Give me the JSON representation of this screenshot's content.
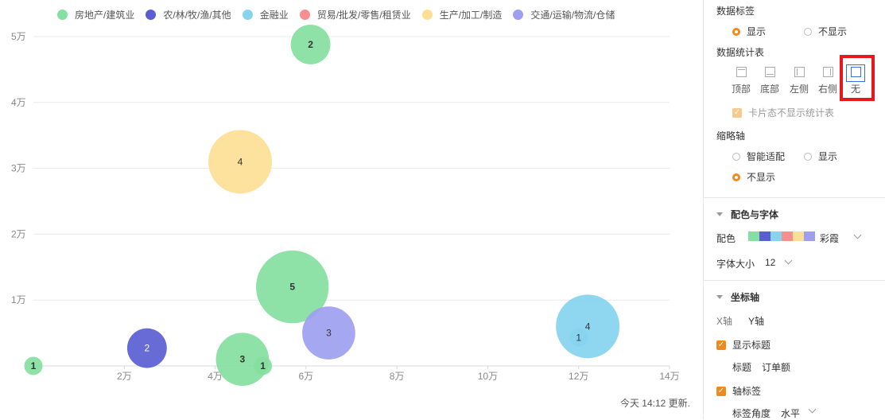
{
  "chart_data": {
    "type": "scatter",
    "subtype": "bubble",
    "legend_position": "top-left",
    "grid": "horizontal",
    "xlim": [
      0,
      140000
    ],
    "ylim": [
      0,
      50000
    ],
    "x_ticks": [
      20000,
      40000,
      60000,
      80000,
      100000,
      120000,
      140000
    ],
    "x_tick_labels": [
      "2万",
      "4万",
      "6万",
      "8万",
      "10万",
      "12万",
      "14万"
    ],
    "y_ticks": [
      10000,
      20000,
      30000,
      40000,
      50000
    ],
    "y_tick_labels": [
      "1万",
      "2万",
      "3万",
      "4万",
      "5万"
    ],
    "series": [
      {
        "name": "房地产/建筑业",
        "color": "#84e0a0",
        "points": [
          {
            "x": 0,
            "y": 0,
            "size": 1
          },
          {
            "x": 61000,
            "y": 48800,
            "size": 2
          },
          {
            "x": 57000,
            "y": 12000,
            "size": 5
          },
          {
            "x": 46000,
            "y": 1000,
            "size": 3
          },
          {
            "x": 50500,
            "y": 0,
            "size": 1
          }
        ]
      },
      {
        "name": "农/林/牧/渔/其他",
        "color": "#5a5ed2",
        "points": [
          {
            "x": 25000,
            "y": 2700,
            "size": 2
          }
        ]
      },
      {
        "name": "金融业",
        "color": "#86d4f0",
        "points": [
          {
            "x": 122000,
            "y": 6000,
            "size": 4
          },
          {
            "x": 120000,
            "y": 4300,
            "size": 1
          }
        ]
      },
      {
        "name": "贸易/批发/零售/租赁业",
        "color": "#f78f8f",
        "points": []
      },
      {
        "name": "生产/加工/制造",
        "color": "#fcdf95",
        "points": [
          {
            "x": 45500,
            "y": 31000,
            "size": 4
          }
        ]
      },
      {
        "name": "交通/运输/物流/仓储",
        "color": "#9da0f0",
        "points": [
          {
            "x": 65000,
            "y": 5000,
            "size": 3
          }
        ]
      }
    ]
  },
  "footer": {
    "update_text": "今天 14:12 更新."
  },
  "panel": {
    "data_label": {
      "title": "数据标签",
      "options": [
        {
          "label": "显示",
          "selected": true
        },
        {
          "label": "不显示",
          "selected": false
        }
      ]
    },
    "stat_table": {
      "title": "数据统计表",
      "positions": [
        {
          "label": "顶部",
          "icon": "table-top-icon"
        },
        {
          "label": "底部",
          "icon": "table-bottom-icon"
        },
        {
          "label": "左侧",
          "icon": "table-left-icon"
        },
        {
          "label": "右侧",
          "icon": "table-right-icon"
        },
        {
          "label": "无",
          "icon": "table-none-icon",
          "selected": true
        }
      ],
      "card_hide_label": "卡片态不显示统计表"
    },
    "thumb_axis": {
      "title": "缩略轴",
      "options": [
        {
          "label": "智能适配",
          "selected": false
        },
        {
          "label": "显示",
          "selected": false
        },
        {
          "label": "不显示",
          "selected": true
        }
      ]
    },
    "color_font": {
      "title": "配色与字体",
      "palette_label": "配色",
      "palette_name": "彩霞",
      "palette_colors": [
        "#84e0a0",
        "#5a5ed2",
        "#86d4f0",
        "#f78f8f",
        "#fcdf95",
        "#9da0f0"
      ],
      "font_size_label": "字体大小",
      "font_size_value": "12"
    },
    "axis": {
      "title": "坐标轴",
      "tab_x": "X轴",
      "tab_y": "Y轴",
      "show_title_label": "显示标题",
      "title_label": "标题",
      "title_value": "订单额",
      "axis_label_label": "轴标签",
      "label_angle_label": "标签角度",
      "label_angle_value": "水平"
    }
  }
}
